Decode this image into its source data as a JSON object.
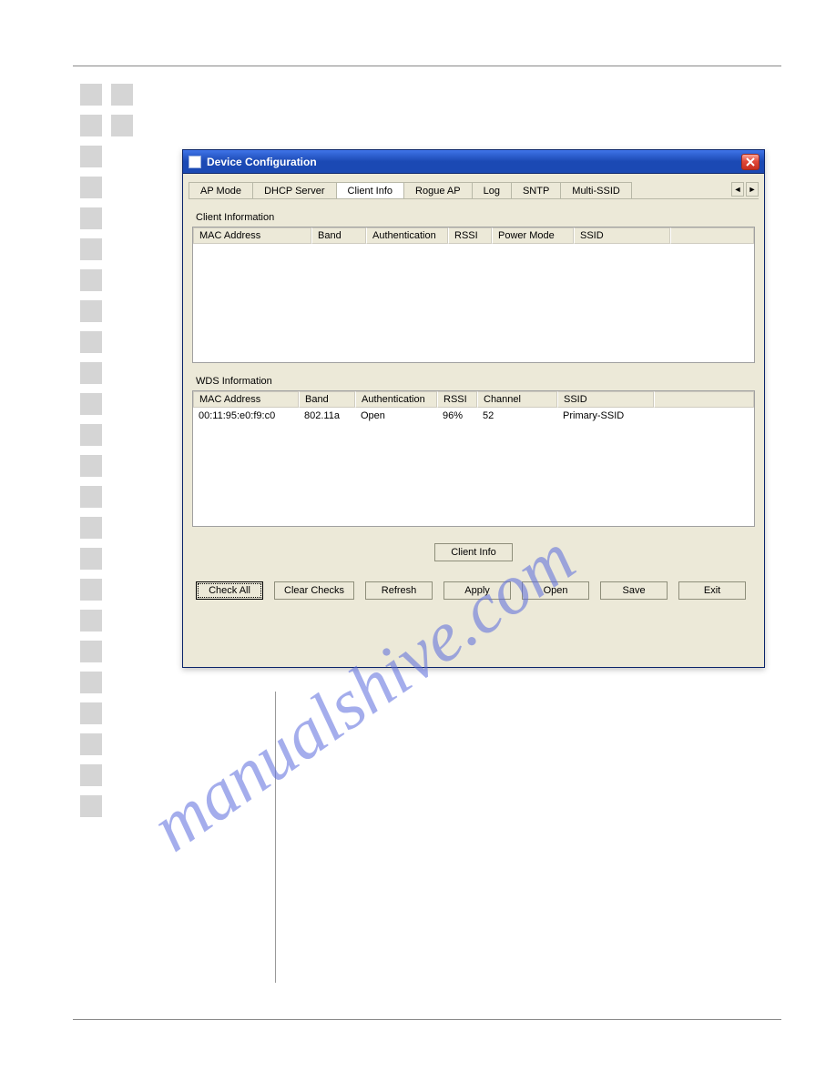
{
  "window_title": "Device Configuration",
  "tabs": [
    {
      "label": "AP Mode"
    },
    {
      "label": "DHCP Server"
    },
    {
      "label": "Client Info",
      "selected": true
    },
    {
      "label": "Rogue AP"
    },
    {
      "label": "Log"
    },
    {
      "label": "SNTP"
    },
    {
      "label": "Multi-SSID"
    }
  ],
  "client_section": {
    "title": "Client Information",
    "columns": [
      "MAC Address",
      "Band",
      "Authentication",
      "RSSI",
      "Power Mode",
      "SSID"
    ],
    "rows": []
  },
  "wds_section": {
    "title": "WDS Information",
    "columns": [
      "MAC Address",
      "Band",
      "Authentication",
      "RSSI",
      "Channel",
      "SSID"
    ],
    "rows": [
      {
        "mac": "00:11:95:e0:f9:c0",
        "band": "802.11a",
        "auth": "Open",
        "rssi": "96%",
        "channel": "52",
        "ssid": "Primary-SSID"
      }
    ]
  },
  "center_button": "Client Info",
  "bottom_buttons": {
    "check_all": "Check All",
    "clear_checks": "Clear Checks",
    "refresh": "Refresh",
    "apply": "Apply",
    "open": "Open",
    "save": "Save",
    "exit": "Exit"
  },
  "watermark": "manualshive.com"
}
